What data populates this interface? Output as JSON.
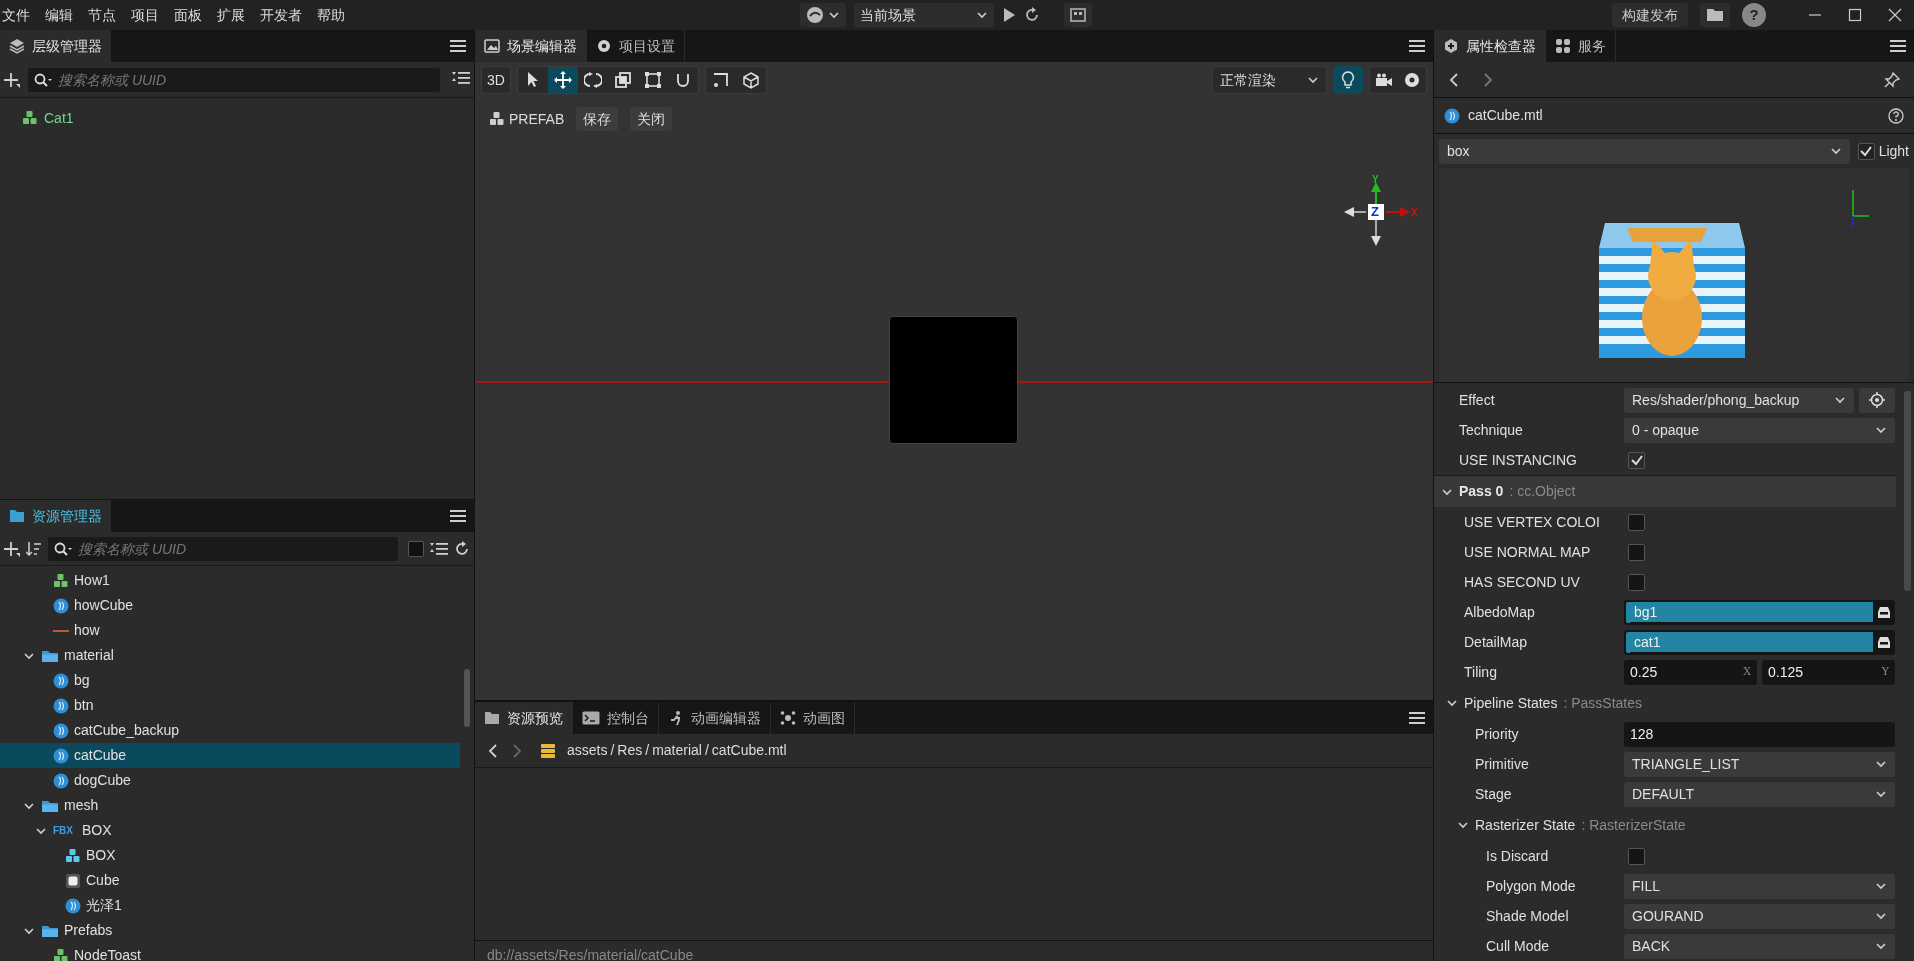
{
  "menubar": {
    "menus": [
      "文件",
      "编辑",
      "节点",
      "项目",
      "面板",
      "扩展",
      "开发者",
      "帮助"
    ],
    "scene_select": "当前场景",
    "build_button": "构建发布",
    "help": "?"
  },
  "hierarchy": {
    "tab": "层级管理器",
    "search": {
      "placeholder": "搜索名称或 UUID"
    },
    "items": [
      {
        "label": "Cat1",
        "kind": "prefab"
      }
    ]
  },
  "assets": {
    "tab": "资源管理器",
    "search": {
      "placeholder": "搜索名称或 UUID"
    },
    "filter_checked": false,
    "tree": [
      {
        "children": [
          {
            "label": "How1",
            "kind": "prefab",
            "selected": false
          },
          {
            "label": "howCube",
            "kind": "material",
            "selected": false
          },
          {
            "label": "how",
            "kind": "texture",
            "selected": false
          }
        ]
      },
      {
        "label": "material",
        "kind": "folder",
        "expanded": true,
        "selected": false,
        "children": [
          {
            "label": "bg",
            "kind": "material",
            "selected": false
          },
          {
            "label": "btn",
            "kind": "material",
            "selected": false
          },
          {
            "label": "catCube_backup",
            "kind": "material",
            "selected": false
          },
          {
            "label": "catCube",
            "kind": "material",
            "selected": true
          },
          {
            "label": "dogCube",
            "kind": "material",
            "selected": false
          }
        ]
      },
      {
        "label": "mesh",
        "kind": "folder",
        "expanded": true,
        "selected": false,
        "children": [
          {
            "label": "BOX",
            "kind": "fbx",
            "badge": "FBX",
            "expanded": true,
            "selected": false,
            "children": [
              {
                "label": "BOX",
                "kind": "prefab-cyan",
                "selected": false
              },
              {
                "label": "Cube",
                "kind": "mesh",
                "selected": false
              },
              {
                "label": "光泽1",
                "kind": "material",
                "selected": false
              }
            ]
          }
        ]
      },
      {
        "label": "Prefabs",
        "kind": "folder",
        "expanded": true,
        "selected": false,
        "children": [
          {
            "label": "NodeToast",
            "kind": "prefab",
            "selected": false
          }
        ]
      }
    ]
  },
  "scene": {
    "tabs": [
      {
        "label": "场景编辑器",
        "kind": "scene",
        "selected": true
      },
      {
        "label": "项目设置",
        "kind": "settings",
        "selected": false
      }
    ],
    "mode_button": "3D",
    "tools": [
      {
        "kind": "select",
        "selected": false
      },
      {
        "kind": "move",
        "selected": true
      },
      {
        "kind": "rotate",
        "selected": false
      },
      {
        "kind": "scale",
        "selected": false
      },
      {
        "kind": "rect",
        "selected": false
      },
      {
        "kind": "snap",
        "selected": false
      }
    ],
    "tools2": [
      {
        "kind": "frame",
        "selected": false
      },
      {
        "kind": "cube",
        "selected": false
      }
    ],
    "render_select": "正常渲染",
    "light_on": true,
    "prefab_label": "PREFAB",
    "prefab_buttons": [
      "保存",
      "关闭"
    ],
    "gizmo": {
      "y": "Y",
      "z": "Z",
      "x": "X"
    }
  },
  "preview": {
    "tabs": [
      {
        "label": "资源预览",
        "kind": "folder",
        "selected": true
      },
      {
        "label": "控制台",
        "kind": "console",
        "selected": false
      },
      {
        "label": "动画编辑器",
        "kind": "runner",
        "selected": false
      },
      {
        "label": "动画图",
        "kind": "graph",
        "selected": false
      }
    ],
    "breadcrumb": [
      "assets",
      "Res",
      "material",
      "catCube.mtl"
    ],
    "separator": "/",
    "status": "db://assets/Res/material/catCube"
  },
  "inspector": {
    "tabs": [
      {
        "label": "属性检查器",
        "kind": "inspector",
        "selected": true
      },
      {
        "label": "服务",
        "kind": "services",
        "selected": false
      }
    ],
    "title": "catCube.mtl",
    "mesh_select": "box",
    "light": {
      "label": "Light",
      "checked": true
    },
    "props": [
      {
        "kind": "select",
        "label": "Effect",
        "value": "Res/shader/phong_backup",
        "locate": true
      },
      {
        "kind": "select",
        "label": "Technique",
        "value": "0 - opaque"
      },
      {
        "kind": "checkbox",
        "label": "USE INSTANCING",
        "checked": true
      },
      {
        "kind": "section",
        "label": "Pass 0",
        "type": ": cc.Object",
        "expanded": true,
        "children": [
          {
            "kind": "checkbox",
            "label": "USE VERTEX COLOI",
            "checked": false
          },
          {
            "kind": "checkbox",
            "label": "USE NORMAL MAP",
            "checked": false
          },
          {
            "kind": "checkbox",
            "label": "HAS SECOND UV",
            "checked": false
          },
          {
            "kind": "asset",
            "label": "AlbedoMap",
            "value": "bg1"
          },
          {
            "kind": "asset",
            "label": "DetailMap",
            "value": "cat1"
          },
          {
            "kind": "vec2",
            "label": "Tiling",
            "x": {
              "value": "0.25",
              "axis": "X"
            },
            "y": {
              "value": "0.125",
              "axis": "Y"
            }
          },
          {
            "kind": "section",
            "label": "Pipeline States",
            "type": ": PassStates",
            "expanded": true,
            "children": [
              {
                "kind": "number",
                "label": "Priority",
                "value": "128"
              },
              {
                "kind": "select",
                "label": "Primitive",
                "value": "TRIANGLE_LIST"
              },
              {
                "kind": "select",
                "label": "Stage",
                "value": "DEFAULT"
              },
              {
                "kind": "section",
                "label": "Rasterizer State",
                "type": ": RasterizerState",
                "expanded": true,
                "children": [
                  {
                    "kind": "checkbox",
                    "label": "Is Discard",
                    "checked": false
                  },
                  {
                    "kind": "select",
                    "label": "Polygon Mode",
                    "value": "FILL"
                  },
                  {
                    "kind": "select",
                    "label": "Shade Model",
                    "value": "GOURAND"
                  },
                  {
                    "kind": "select",
                    "label": "Cull Mode",
                    "value": "BACK"
                  }
                ]
              }
            ]
          }
        ]
      }
    ]
  }
}
